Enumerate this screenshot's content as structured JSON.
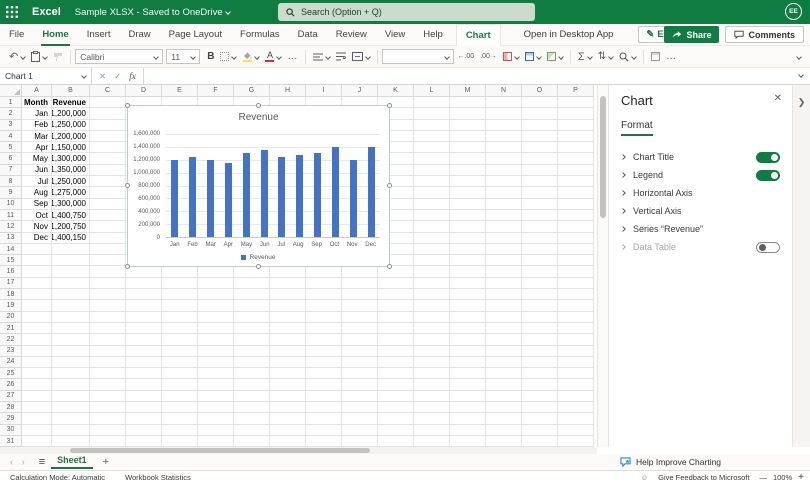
{
  "titlebar": {
    "app_name": "Excel",
    "doc_title": "Sample XLSX  -  Saved to OneDrive",
    "search_placeholder": "Search (Option + Q)",
    "avatar_initials": "EE"
  },
  "menubar": {
    "tabs": [
      "File",
      "Home",
      "Insert",
      "Draw",
      "Page Layout",
      "Formulas",
      "Data",
      "Review",
      "View",
      "Help"
    ],
    "active_tab": "Home",
    "contextual_tab": "Chart",
    "open_desktop_label": "Open in Desktop App",
    "editing_label": "Editing",
    "share_label": "Share",
    "comments_label": "Comments"
  },
  "toolbar": {
    "font_name": "Calibri",
    "font_size": "11",
    "bold_label": "B",
    "sum_label": "Σ",
    "more_label": "…"
  },
  "formula_bar": {
    "name_box": "Chart 1",
    "fx_label": "fx",
    "formula_value": ""
  },
  "sheet": {
    "columns": [
      "A",
      "B",
      "C",
      "D",
      "E",
      "F",
      "G",
      "H",
      "I",
      "J",
      "K",
      "L",
      "M",
      "N",
      "O",
      "P"
    ],
    "header_row": [
      "Month",
      "Revenue"
    ],
    "rows": [
      [
        "Jan",
        "1,200,000"
      ],
      [
        "Feb",
        "1,250,000"
      ],
      [
        "Mar",
        "1,200,000"
      ],
      [
        "Apr",
        "1,150,000"
      ],
      [
        "May",
        "1,300,000"
      ],
      [
        "Jun",
        "1,350,000"
      ],
      [
        "Jul",
        "1,250,000"
      ],
      [
        "Aug",
        "1,275,000"
      ],
      [
        "Sep",
        "1,300,000"
      ],
      [
        "Oct",
        "1,400,750"
      ],
      [
        "Nov",
        "1,200,750"
      ],
      [
        "Dec",
        "1,400,150"
      ]
    ],
    "visible_rows": 32
  },
  "chart_data": {
    "type": "bar",
    "title": "Revenue",
    "categories": [
      "Jan",
      "Feb",
      "Mar",
      "Apr",
      "May",
      "Jun",
      "Jul",
      "Aug",
      "Sep",
      "Oct",
      "Nov",
      "Dec"
    ],
    "values": [
      1200000,
      1250000,
      1200000,
      1150000,
      1300000,
      1350000,
      1250000,
      1275000,
      1300000,
      1400750,
      1200750,
      1400150
    ],
    "series_name": "Revenue",
    "ylim": [
      0,
      1600000
    ],
    "ytick_interval": 200000,
    "ytick_labels": [
      "0",
      "200,000",
      "400,000",
      "600,000",
      "800,000",
      "1,000,000",
      "1,200,000",
      "1,400,000",
      "1,600,000"
    ],
    "legend_position": "bottom",
    "grid": true,
    "bar_color": "#4472C4"
  },
  "panel": {
    "title": "Chart",
    "tab_label": "Format",
    "items": [
      {
        "label": "Chart Title",
        "toggle": "on",
        "disabled": false
      },
      {
        "label": "Legend",
        "toggle": "on",
        "disabled": false
      },
      {
        "label": "Horizontal Axis",
        "toggle": null,
        "disabled": false
      },
      {
        "label": "Vertical Axis",
        "toggle": null,
        "disabled": false
      },
      {
        "label": "Series “Revenue”",
        "toggle": null,
        "disabled": false
      },
      {
        "label": "Data Table",
        "toggle": "off",
        "disabled": true
      }
    ]
  },
  "footer": {
    "sheet_tab": "Sheet1",
    "add_sheet_label": "+",
    "help_improve_label": "Help Improve Charting"
  },
  "statusbar": {
    "calc_mode": "Calculation Mode: Automatic",
    "workbook_stats": "Workbook Statistics",
    "feedback_label": "Give Feedback to Microsoft",
    "zoom_level": "100%"
  }
}
